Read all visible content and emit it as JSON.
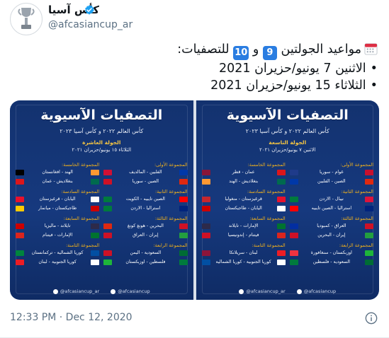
{
  "account": {
    "display_name": "كأس آسيا",
    "handle": "@afcasiancup_ar",
    "verified": true,
    "avatar_icon": "asian-cup-trophy-icon"
  },
  "tweet": {
    "line1_prefix": "مواعيد الجولتين",
    "keycap_a": "9",
    "connector": "و",
    "keycap_b": "10",
    "line1_suffix": "للتصفيات:",
    "bullet": "•",
    "line2": "الاثنين 7 يونيو/حزيران 2021",
    "line3": "الثلاثاء 15 يونيو/حزيران 2021",
    "timestamp": "12:33 PM · Dec 12, 2020"
  },
  "posters": [
    {
      "title": "التصفيات الآسيوية",
      "subtitle": "كأس العالم ٢٠٢٢ و كأس آسيا ٢٠٢٣",
      "round": "الجولة التاسعة",
      "date": "الاثنين ٧ يونيو/حزيران ٢٠٢١",
      "col_right": [
        {
          "group": "المجموعة الأولى:",
          "matches": [
            {
              "text": "غوام - سوريا",
              "flag_a": "#c8102e",
              "flag_b": "#1f3b8a"
            },
            {
              "text": "الصين - الفلبين",
              "flag_a": "#de2910",
              "flag_b": "#0038a8"
            }
          ]
        },
        {
          "group": "المجموعة الثانية:",
          "matches": [
            {
              "text": "نيبال - الأردن",
              "flag_a": "#dc143c",
              "flag_b": "#007a3d"
            },
            {
              "text": "أستراليا - الصين تايبيه",
              "flag_a": "#00247d",
              "flag_b": "#fe0000"
            }
          ]
        },
        {
          "group": "المجموعة الثالثة:",
          "matches": [
            {
              "text": "العراق - كمبوديا",
              "flag_a": "#ce1126",
              "flag_b": "#032ea1"
            },
            {
              "text": "إيران - البحرين",
              "flag_a": "#239f40",
              "flag_b": "#ce1126"
            }
          ]
        },
        {
          "group": "المجموعة الرابعة:",
          "matches": [
            {
              "text": "أوزبكستان - سنغافورة",
              "flag_a": "#1eb53a",
              "flag_b": "#ef3340"
            },
            {
              "text": "السعودية - فلسطين",
              "flag_a": "#006c35",
              "flag_b": "#007a3d"
            }
          ]
        }
      ],
      "col_left": [
        {
          "group": "المجموعة الخامسة:",
          "matches": [
            {
              "text": "عمان - قطر",
              "flag_a": "#db161b",
              "flag_b": "#8a1538"
            },
            {
              "text": "بنغلاديش - الهند",
              "flag_a": "#006a4e",
              "flag_b": "#ff9933"
            }
          ]
        },
        {
          "group": "المجموعة السادسة:",
          "matches": [
            {
              "text": "قرغيزستان - منغوليا",
              "flag_a": "#e8112d",
              "flag_b": "#c4272f"
            },
            {
              "text": "اليابان - طاجيكستان",
              "flag_a": "#ffffff",
              "flag_b": "#cc0000"
            }
          ]
        },
        {
          "group": "المجموعة السابعة:",
          "matches": [
            {
              "text": "الإمارات - تايلاند",
              "flag_a": "#00732f",
              "flag_b": "#2d2a4a"
            },
            {
              "text": "فيتنام - إندونيسيا",
              "flag_a": "#da251d",
              "flag_b": "#ce1126"
            }
          ]
        },
        {
          "group": "المجموعة الثامنة:",
          "matches": [
            {
              "text": "لبنان - سريلانكا",
              "flag_a": "#ed1c24",
              "flag_b": "#8d153a"
            },
            {
              "text": "كوريا الجنوبية - كوريا الشمالية",
              "flag_a": "#ffffff",
              "flag_b": "#024fa2"
            }
          ]
        }
      ],
      "footer_twitter": "@afcasiancup_ar",
      "footer_site": "@afcasiancup"
    },
    {
      "title": "التصفيات الآسيوية",
      "subtitle": "كأس العالم ٢٠٢٢ و كأس آسيا ٢٠٢٣",
      "round": "الجولة العاشرة",
      "date": "الثلاثاء ١٥ يونيو/حزيران ٢٠٢١",
      "col_right": [
        {
          "group": "المجموعة الأولى:",
          "matches": [
            {
              "text": "الفلبين - المالديف",
              "flag_a": "#0038a8",
              "flag_b": "#d21034"
            },
            {
              "text": "الصين - سوريا",
              "flag_a": "#de2910",
              "flag_b": "#ce1126"
            }
          ]
        },
        {
          "group": "المجموعة الثانية:",
          "matches": [
            {
              "text": "الصين تايبيه - الكويت",
              "flag_a": "#fe0000",
              "flag_b": "#007a3d"
            },
            {
              "text": "أستراليا - الأردن",
              "flag_a": "#00247d",
              "flag_b": "#007a3d"
            }
          ]
        },
        {
          "group": "المجموعة الثالثة:",
          "matches": [
            {
              "text": "البحرين - هونغ كونغ",
              "flag_a": "#ce1126",
              "flag_b": "#de2910"
            },
            {
              "text": "إيران - العراق",
              "flag_a": "#239f40",
              "flag_b": "#ce1126"
            }
          ]
        },
        {
          "group": "المجموعة الرابعة:",
          "matches": [
            {
              "text": "السعودية - اليمن",
              "flag_a": "#006c35",
              "flag_b": "#ce1126"
            },
            {
              "text": "فلسطين - أوزبكستان",
              "flag_a": "#007a3d",
              "flag_b": "#1eb53a"
            }
          ]
        }
      ],
      "col_left": [
        {
          "group": "المجموعة الخامسة:",
          "matches": [
            {
              "text": "الهند - أفغانستان",
              "flag_a": "#ff9933",
              "flag_b": "#000000"
            },
            {
              "text": "بنغلاديش - عمان",
              "flag_a": "#006a4e",
              "flag_b": "#db161b"
            }
          ]
        },
        {
          "group": "المجموعة السادسة:",
          "matches": [
            {
              "text": "اليابان - قرغيزستان",
              "flag_a": "#ffffff",
              "flag_b": "#e8112d"
            },
            {
              "text": "طاجيكستان - ميانمار",
              "flag_a": "#cc0000",
              "flag_b": "#fecb00"
            }
          ]
        },
        {
          "group": "المجموعة السابعة:",
          "matches": [
            {
              "text": "تايلاند - ماليزيا",
              "flag_a": "#2d2a4a",
              "flag_b": "#cc0001"
            },
            {
              "text": "الإمارات - فيتنام",
              "flag_a": "#00732f",
              "flag_b": "#da251d"
            }
          ]
        },
        {
          "group": "المجموعة الثامنة:",
          "matches": [
            {
              "text": "كوريا الشمالية - تركمانستان",
              "flag_a": "#024fa2",
              "flag_b": "#00843d"
            },
            {
              "text": "كوريا الجنوبية - لبنان",
              "flag_a": "#ffffff",
              "flag_b": "#ed1c24"
            }
          ]
        }
      ],
      "footer_twitter": "@afcasiancup_ar",
      "footer_site": "@afcasiancup"
    }
  ],
  "colors": {
    "text_primary": "#0f1419",
    "text_secondary": "#5b7083",
    "verified_blue": "#1da1f2",
    "keycap_blue": "#2a7de1",
    "poster_navy": "#16397e",
    "group_gold": "#f2b21c"
  }
}
